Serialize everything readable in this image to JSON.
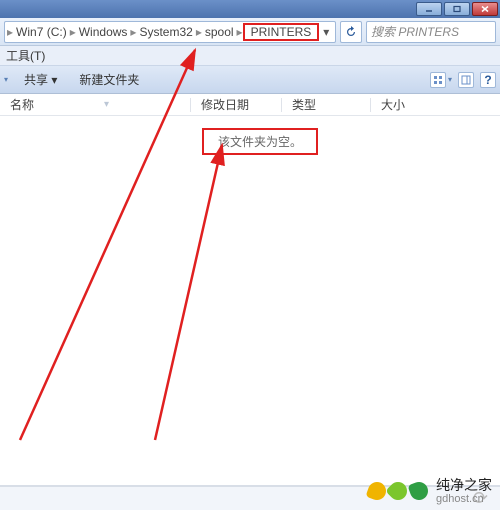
{
  "titlebar": {
    "min": "–",
    "max": "□",
    "close": "×"
  },
  "breadcrumb": {
    "segs": [
      "Win7 (C:)",
      "Windows",
      "System32",
      "spool",
      "PRINTERS"
    ],
    "sep": "▸",
    "drop": "▾"
  },
  "search": {
    "placeholder": "搜索 PRINTERS"
  },
  "menubar": {
    "tools": "工具(T)"
  },
  "cmdbar": {
    "share": "共享 ▾",
    "newfolder": "新建文件夹",
    "help": "?"
  },
  "columns": {
    "name": "名称",
    "date": "修改日期",
    "type": "类型",
    "size": "大小"
  },
  "content": {
    "empty": "该文件夹为空。"
  },
  "status": {
    "sym": "⟳"
  },
  "watermark": {
    "brand": "纯净之家",
    "url": "gdhost.cn",
    "colors": {
      "a": "#f0b400",
      "b": "#7bc62d",
      "c": "#2f9e44"
    }
  },
  "annot": {
    "color": "#e02020"
  }
}
